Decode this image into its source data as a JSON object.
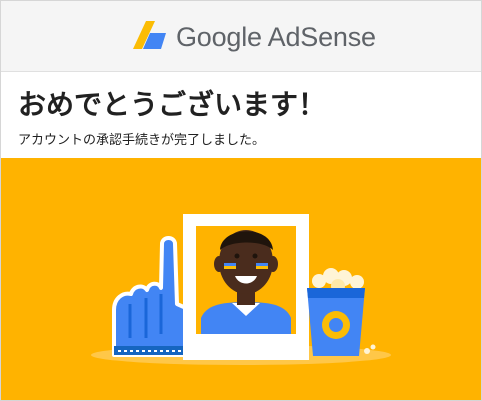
{
  "header": {
    "brand_name": "Google AdSense",
    "logo_icon": "adsense-logo-icon"
  },
  "main": {
    "title": "おめでとうございます！",
    "message": "アカウントの承認手続きが完了しました。"
  },
  "banner": {
    "illustration": "celebration-illustration",
    "icons": [
      "foam-finger-icon",
      "portrait-frame-icon",
      "popcorn-bucket-icon"
    ]
  },
  "colors": {
    "header_bg": "#f5f5f5",
    "banner_bg": "#ffb300",
    "logo_yellow": "#fbbc04",
    "logo_blue": "#4285f4",
    "brand_text": "#5f6368",
    "title_text": "#212121"
  }
}
